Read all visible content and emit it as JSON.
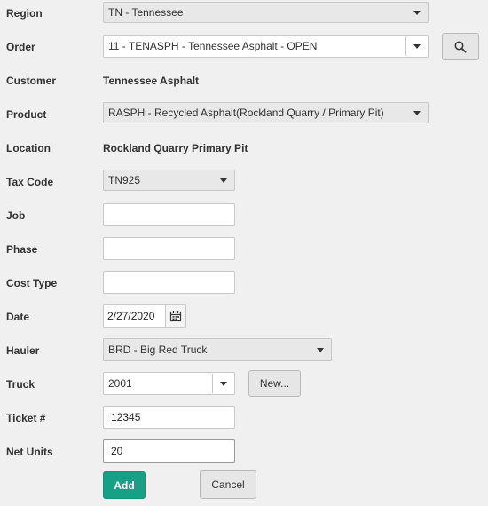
{
  "labels": {
    "region": "Region",
    "order": "Order",
    "customer": "Customer",
    "product": "Product",
    "location": "Location",
    "tax_code": "Tax Code",
    "job": "Job",
    "phase": "Phase",
    "cost_type": "Cost Type",
    "date": "Date",
    "hauler": "Hauler",
    "truck": "Truck",
    "ticket": "Ticket #",
    "net_units": "Net Units"
  },
  "fields": {
    "region": "TN - Tennessee",
    "order": "11 - TENASPH - Tennessee Asphalt - OPEN",
    "customer": "Tennessee Asphalt",
    "product": "RASPH - Recycled Asphalt(Rockland Quarry / Primary Pit)",
    "location": "Rockland Quarry Primary Pit",
    "tax_code": "TN925",
    "job": "",
    "phase": "",
    "cost_type": "",
    "date": "2/27/2020",
    "hauler": "BRD - Big Red Truck",
    "truck": "2001",
    "ticket": "12345",
    "net_units": "20"
  },
  "buttons": {
    "new": "New...",
    "add": "Add",
    "cancel": "Cancel"
  },
  "icons": {
    "search": "search-icon",
    "calendar": "calendar-icon",
    "dropdown": "chevron-down-icon"
  },
  "colors": {
    "primary": "#16a085",
    "background": "#f0f0f0"
  }
}
